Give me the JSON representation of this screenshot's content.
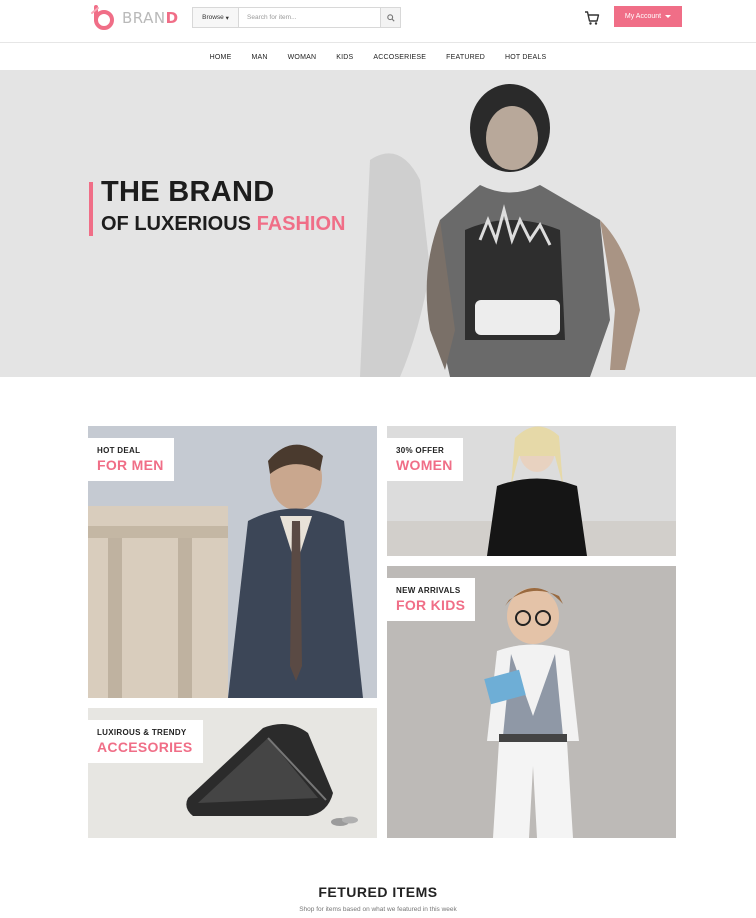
{
  "brand": {
    "name_prefix": "BRAN",
    "name_accent": "D"
  },
  "search": {
    "browse_label": "Browse",
    "placeholder": "Search for item..."
  },
  "account": {
    "label": "My Account"
  },
  "nav": [
    {
      "label": "HOME"
    },
    {
      "label": "MAN"
    },
    {
      "label": "WOMAN"
    },
    {
      "label": "KIDS"
    },
    {
      "label": "ACCOSERIESE"
    },
    {
      "label": "FEATURED"
    },
    {
      "label": "HOT DEALS"
    }
  ],
  "hero": {
    "title": "THE BRAND",
    "subtitle_prefix": "OF LUXERIOUS ",
    "subtitle_accent": "FASHION"
  },
  "tiles": {
    "men": {
      "small": "HOT DEAL",
      "big": "FOR MEN"
    },
    "women": {
      "small": "30% OFFER",
      "big": "WOMEN"
    },
    "kids": {
      "small": "NEW ARRIVALS",
      "big": "FOR KIDS"
    },
    "accessories": {
      "small": "LUXIROUS & TRENDY",
      "big": "ACCESORIES"
    }
  },
  "featured": {
    "title": "FETURED ITEMS",
    "subtitle": "Shop for items based on what we featured in this week"
  },
  "colors": {
    "accent": "#f06e87",
    "hero_bg": "#e4e4e4"
  }
}
